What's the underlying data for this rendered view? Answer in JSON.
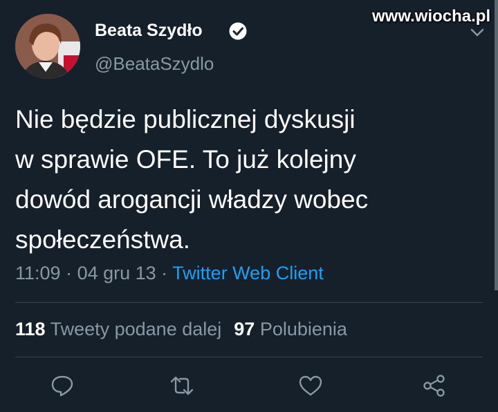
{
  "watermark": "www.wiocha.pl",
  "author": {
    "name": "Beata Szydło",
    "handle": "@BeataSzydlo"
  },
  "tweet": {
    "text": "Nie będzie publicznej dyskusji\nw sprawie OFE. To już kolejny\ndowód arogancji władzy wobec\nspołeczeństwa.",
    "time": "11:09",
    "sep1": " · ",
    "date": "04 gru 13",
    "sep2": " · ",
    "client": "Twitter Web Client"
  },
  "stats": {
    "retweets_count": "118",
    "retweets_label": "Tweety podane dalej",
    "likes_count": "97",
    "likes_label": "Polubienia"
  },
  "colors": {
    "background": "#15202b",
    "secondary_text": "#8899a6",
    "link": "#1da1f2",
    "divider": "#38444d"
  },
  "icons": [
    "verified-icon",
    "chevron-down-icon",
    "reply-icon",
    "retweet-icon",
    "like-icon",
    "share-icon"
  ]
}
